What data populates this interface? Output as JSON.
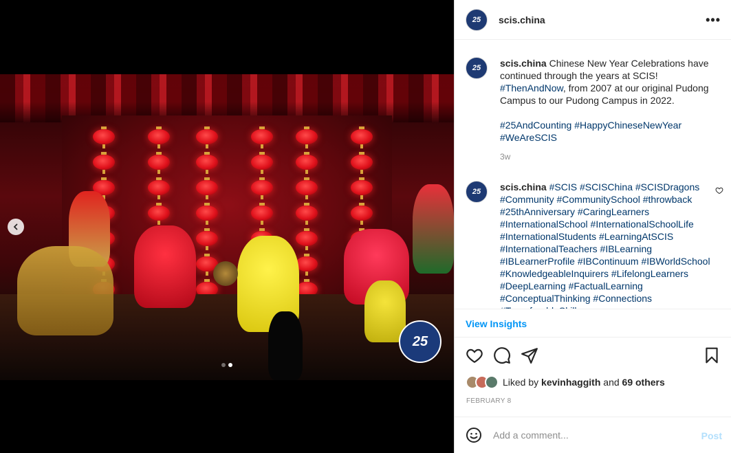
{
  "post": {
    "username": "scis.china",
    "avatar_text": "25",
    "more_icon": "ellipsis-icon"
  },
  "caption": {
    "username": "scis.china",
    "text_1": " Chinese New Year Celebrations have continued through the years at SCIS! ",
    "tag_1": "#ThenAndNow",
    "text_2": ", from 2007 at our original Pudong Campus to our Pudong Campus in 2022.",
    "tag_2": "#25AndCounting",
    "tag_3": "#HappyChineseNewYear",
    "tag_4": "#WeAreSCIS",
    "time": "3w"
  },
  "comment": {
    "username": "scis.china",
    "tags": "#SCIS #SCISChina #SCISDragons #Community #CommunitySchool #throwback #25thAnniversary #CaringLearners #InternationalSchool #InternationalSchoolLife #InternationalStudents #LearningAtSCIS #InternationalTeachers #IBLearning #IBLearnerProfile #IBContinuum #IBWorldSchool #KnowledgeableInquirers #LifelongLearners #DeepLearning #FactualLearning #ConceptualThinking #Connections #TransferableSkills"
  },
  "insights_label": "View Insights",
  "likes": {
    "prefix": "Liked by ",
    "user": "kevinhaggith",
    "middle": " and ",
    "others": "69 others"
  },
  "date": "FEBRUARY 8",
  "add_comment": {
    "placeholder": "Add a comment...",
    "post_label": "Post"
  },
  "media": {
    "watermark_text": "25",
    "carousel_count": 2,
    "carousel_index": 2
  },
  "colors": {
    "link": "#00376b",
    "accent": "#0095f6",
    "post_disabled": "#b2dffc"
  }
}
